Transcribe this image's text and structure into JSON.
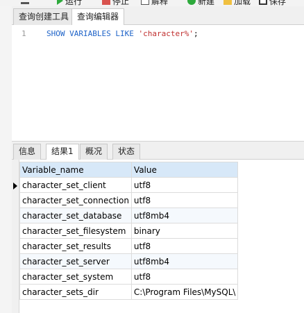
{
  "toolbar": {
    "items": [
      {
        "label": "运行",
        "icon": "run-icon"
      },
      {
        "label": "停止",
        "icon": "stop-icon"
      },
      {
        "label": "解释",
        "icon": "explain-icon"
      },
      {
        "label": "新建",
        "icon": "new-icon"
      },
      {
        "label": "加载",
        "icon": "load-icon"
      },
      {
        "label": "保存",
        "icon": "save-icon"
      }
    ]
  },
  "query_tabs": [
    {
      "label": "查询创建工具",
      "active": false
    },
    {
      "label": "查询编辑器",
      "active": true
    }
  ],
  "editor": {
    "line_number": "1",
    "kw1": "SHOW VARIABLES LIKE",
    "string": "'character%'",
    "terminator": ";"
  },
  "result_tabs": [
    {
      "label": "信息",
      "active": false
    },
    {
      "label": "结果1",
      "active": true
    },
    {
      "label": "概况",
      "active": false
    },
    {
      "label": "状态",
      "active": false
    }
  ],
  "grid": {
    "columns": [
      "Variable_name",
      "Value"
    ],
    "rows": [
      [
        "character_set_client",
        "utf8"
      ],
      [
        "character_set_connection",
        "utf8"
      ],
      [
        "character_set_database",
        "utf8mb4"
      ],
      [
        "character_set_filesystem",
        "binary"
      ],
      [
        "character_set_results",
        "utf8"
      ],
      [
        "character_set_server",
        "utf8mb4"
      ],
      [
        "character_set_system",
        "utf8"
      ],
      [
        "character_sets_dir",
        "C:\\Program Files\\MySQL\\"
      ]
    ],
    "current_row": 0
  }
}
